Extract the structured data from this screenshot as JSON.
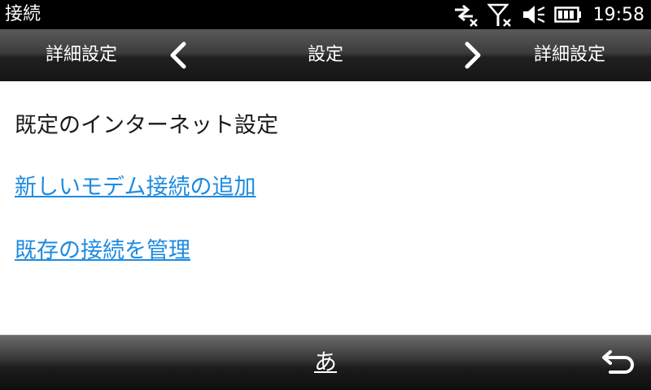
{
  "status_bar": {
    "title": "接続",
    "time": "19:58",
    "icons": [
      "data-off-icon",
      "signal-off-icon",
      "speaker-muted-icon",
      "battery-icon"
    ]
  },
  "nav": {
    "left_label": "詳細設定",
    "center_label": "設定",
    "right_label": "詳細設定"
  },
  "content": {
    "heading": "既定のインターネット設定",
    "links": [
      "新しいモデム接続の追加",
      "既存の接続を管理"
    ]
  },
  "bottom_bar": {
    "input_mode_label": "あ",
    "back_icon": "back-icon"
  },
  "colors": {
    "link": "#1e8be0",
    "status_bar_bg": "#000000",
    "content_bg": "#ffffff"
  }
}
